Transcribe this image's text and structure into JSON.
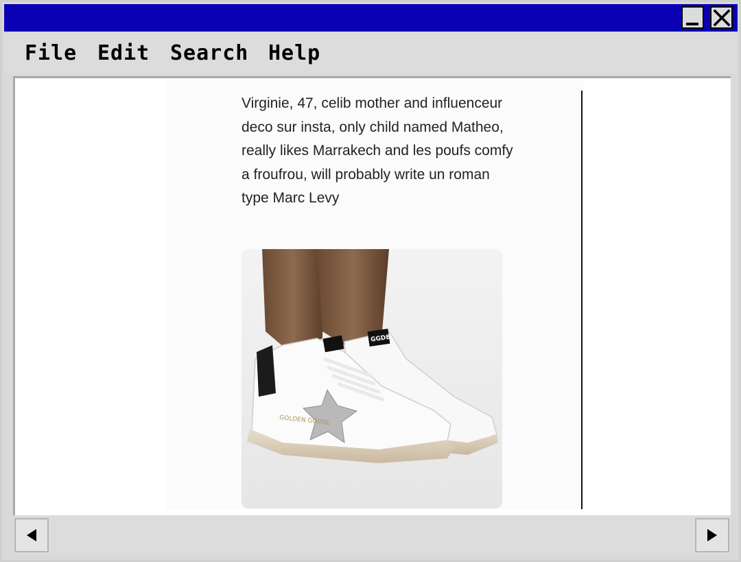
{
  "menu": {
    "file": "File",
    "edit": "Edit",
    "search": "Search",
    "help": "Help"
  },
  "window_controls": {
    "minimize_icon": "minimize-icon",
    "close_icon": "close-icon"
  },
  "post": {
    "text": "Virginie, 47, celib mother and influenceur deco sur insta, only child named Matheo, really likes Marrakech and les poufs comfy a froufrou, will probably write un roman type Marc Levy",
    "image_text": "GGDB"
  },
  "scroll": {
    "left_icon": "arrow-left-icon",
    "right_icon": "arrow-right-icon"
  },
  "colors": {
    "titlebar": "#0a00b4",
    "chrome": "#dcdcdc"
  }
}
